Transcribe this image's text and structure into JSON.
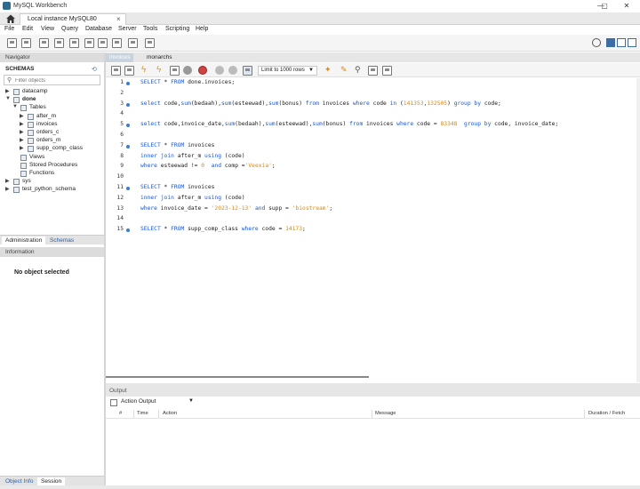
{
  "window": {
    "title": "MySQL Workbench",
    "controls": [
      "—",
      "▢",
      "✕"
    ]
  },
  "connection_tab": {
    "label": "Local instance MySQL80",
    "close": "×"
  },
  "menu": [
    "File",
    "Edit",
    "View",
    "Query",
    "Database",
    "Server",
    "Tools",
    "Scripting",
    "Help"
  ],
  "navigator": {
    "header": "Navigator",
    "schemas_title": "SCHEMAS",
    "filter_placeholder": "Filter objects",
    "tree": [
      {
        "label": "datacamp",
        "level": 0,
        "arrow": "▶",
        "bold": false
      },
      {
        "label": "done",
        "level": 0,
        "arrow": "▼",
        "bold": true
      },
      {
        "label": "Tables",
        "level": 1,
        "arrow": "▼",
        "bold": false
      },
      {
        "label": "after_m",
        "level": 2,
        "arrow": "▶",
        "bold": false
      },
      {
        "label": "invoices",
        "level": 2,
        "arrow": "▶",
        "bold": false
      },
      {
        "label": "orders_c",
        "level": 2,
        "arrow": "▶",
        "bold": false
      },
      {
        "label": "orders_m",
        "level": 2,
        "arrow": "▶",
        "bold": false
      },
      {
        "label": "supp_comp_class",
        "level": 2,
        "arrow": "▶",
        "bold": false
      },
      {
        "label": "Views",
        "level": 1,
        "arrow": "",
        "bold": false
      },
      {
        "label": "Stored Procedures",
        "level": 1,
        "arrow": "",
        "bold": false
      },
      {
        "label": "Functions",
        "level": 1,
        "arrow": "",
        "bold": false
      },
      {
        "label": "sys",
        "level": 0,
        "arrow": "▶",
        "bold": false
      },
      {
        "label": "test_python_schema",
        "level": 0,
        "arrow": "▶",
        "bold": false
      }
    ],
    "tabs": [
      "Administration",
      "Schemas"
    ]
  },
  "information": {
    "header": "Information",
    "empty_text": "No object selected",
    "tabs": [
      "Object Info",
      "Session"
    ]
  },
  "editor": {
    "tabs": [
      "invoices",
      "monarchs"
    ],
    "limit": "Limit to 1000 rows",
    "lines": [
      {
        "n": "1",
        "dot": true,
        "html": "<span class='kw'>SELECT</span> * <span class='kw'>FROM</span> done.invoices;"
      },
      {
        "n": "2",
        "dot": false,
        "html": ""
      },
      {
        "n": "3",
        "dot": true,
        "html": "<span class='kw'>select</span> code,<span class='kw'>sum</span>(bedaah),<span class='kw'>sum</span>(esteewad),<span class='kw'>sum</span>(bonus) <span class='kw'>from</span> invoices <span class='kw'>where</span> code <span class='kw'>in</span> (<span class='num'>141353</span>,<span class='num'>132505</span>) <span class='kw'>group by</span> code;"
      },
      {
        "n": "4",
        "dot": false,
        "html": ""
      },
      {
        "n": "5",
        "dot": true,
        "html": "<span class='kw'>select</span> code,invoice_date,<span class='kw'>sum</span>(bedaah),<span class='kw'>sum</span>(esteewad),<span class='kw'>sum</span>(bonus) <span class='kw'>from</span> invoices <span class='kw'>where</span> code = <span class='num'>83348</span>  <span class='kw'>group by</span> code, invoice_date;"
      },
      {
        "n": "6",
        "dot": false,
        "html": ""
      },
      {
        "n": "7",
        "dot": true,
        "html": "<span class='kw'>SELECT</span> * <span class='kw'>FROM</span> invoices"
      },
      {
        "n": "8",
        "dot": false,
        "html": "<span class='kw'>inner join</span> after_m <span class='kw'>using</span> (code)"
      },
      {
        "n": "9",
        "dot": false,
        "html": "<span class='kw'>where</span> esteewad != <span class='num'>0</span>  <span class='kw'>and</span> comp =<span class='str'>'Veexia'</span>;"
      },
      {
        "n": "10",
        "dot": false,
        "html": ""
      },
      {
        "n": "11",
        "dot": true,
        "html": "<span class='kw'>SELECT</span> * <span class='kw'>FROM</span> invoices"
      },
      {
        "n": "12",
        "dot": false,
        "html": "<span class='kw'>inner join</span> after_m <span class='kw'>using</span> (code)"
      },
      {
        "n": "13",
        "dot": false,
        "html": "<span class='kw'>where</span> invoice_date = <span class='str'>'2023-12-13'</span> <span class='kw'>and</span> supp = <span class='str'>'biostream'</span>;"
      },
      {
        "n": "14",
        "dot": false,
        "html": ""
      },
      {
        "n": "15",
        "dot": true,
        "html": "<span class='kw'>SELECT</span> * <span class='kw'>FROM</span> supp_comp_class <span class='kw'>where</span> code = <span class='num'>14173</span>;"
      }
    ]
  },
  "output": {
    "header": "Output",
    "selector": "Action Output",
    "columns": [
      "#",
      "Time",
      "Action",
      "Message",
      "Duration / Fetch"
    ]
  },
  "colors": {
    "keyword": "#1c57c4",
    "literal": "#d88916",
    "dot": "#3a7dc9"
  }
}
